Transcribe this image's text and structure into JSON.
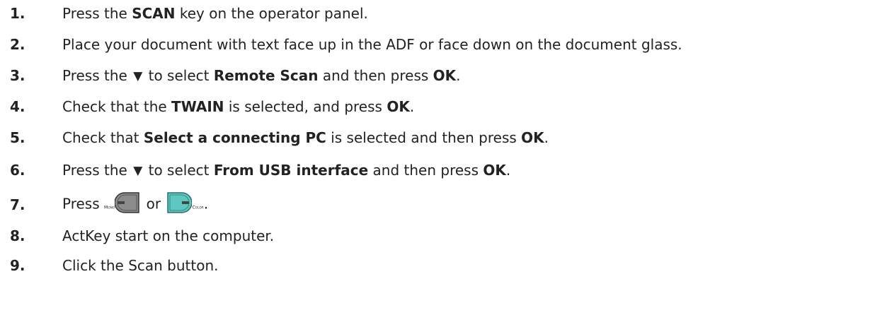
{
  "steps": [
    {
      "num": "1.",
      "pre": "Press the ",
      "b1": "SCAN",
      "post": " key on the operator panel."
    },
    {
      "num": "2.",
      "text": "Place your document with text face up in the ADF or face down on the document glass."
    },
    {
      "num": "3.",
      "pre": "Press the ",
      "arrow": "▼",
      "mid": " to select ",
      "b1": "Remote Scan",
      "mid2": " and then press ",
      "b2": "OK",
      "post": "."
    },
    {
      "num": "4.",
      "pre": "Check that the ",
      "b1": "TWAIN",
      "mid": " is selected, and press ",
      "b2": "OK",
      "post": "."
    },
    {
      "num": "5.",
      "pre": "Check that ",
      "b1": "Select a connecting PC",
      "mid": " is selected and then press ",
      "b2": "OK",
      "post": "."
    },
    {
      "num": "6.",
      "pre": "Press the ",
      "arrow": "▼",
      "mid": " to select ",
      "b1": "From USB interface",
      "mid2": " and then press ",
      "b2": "OK",
      "post": "."
    },
    {
      "num": "7.",
      "pre": "Press ",
      "mono_label": "Mono",
      "or": " or ",
      "color_label": "Color",
      "post": "."
    },
    {
      "num": "8.",
      "text": "ActKey start on the computer."
    },
    {
      "num": "9.",
      "text": "Click the Scan button."
    }
  ],
  "colors": {
    "mono_button": "#8c8c8c",
    "color_button": "#5ec8c0"
  }
}
